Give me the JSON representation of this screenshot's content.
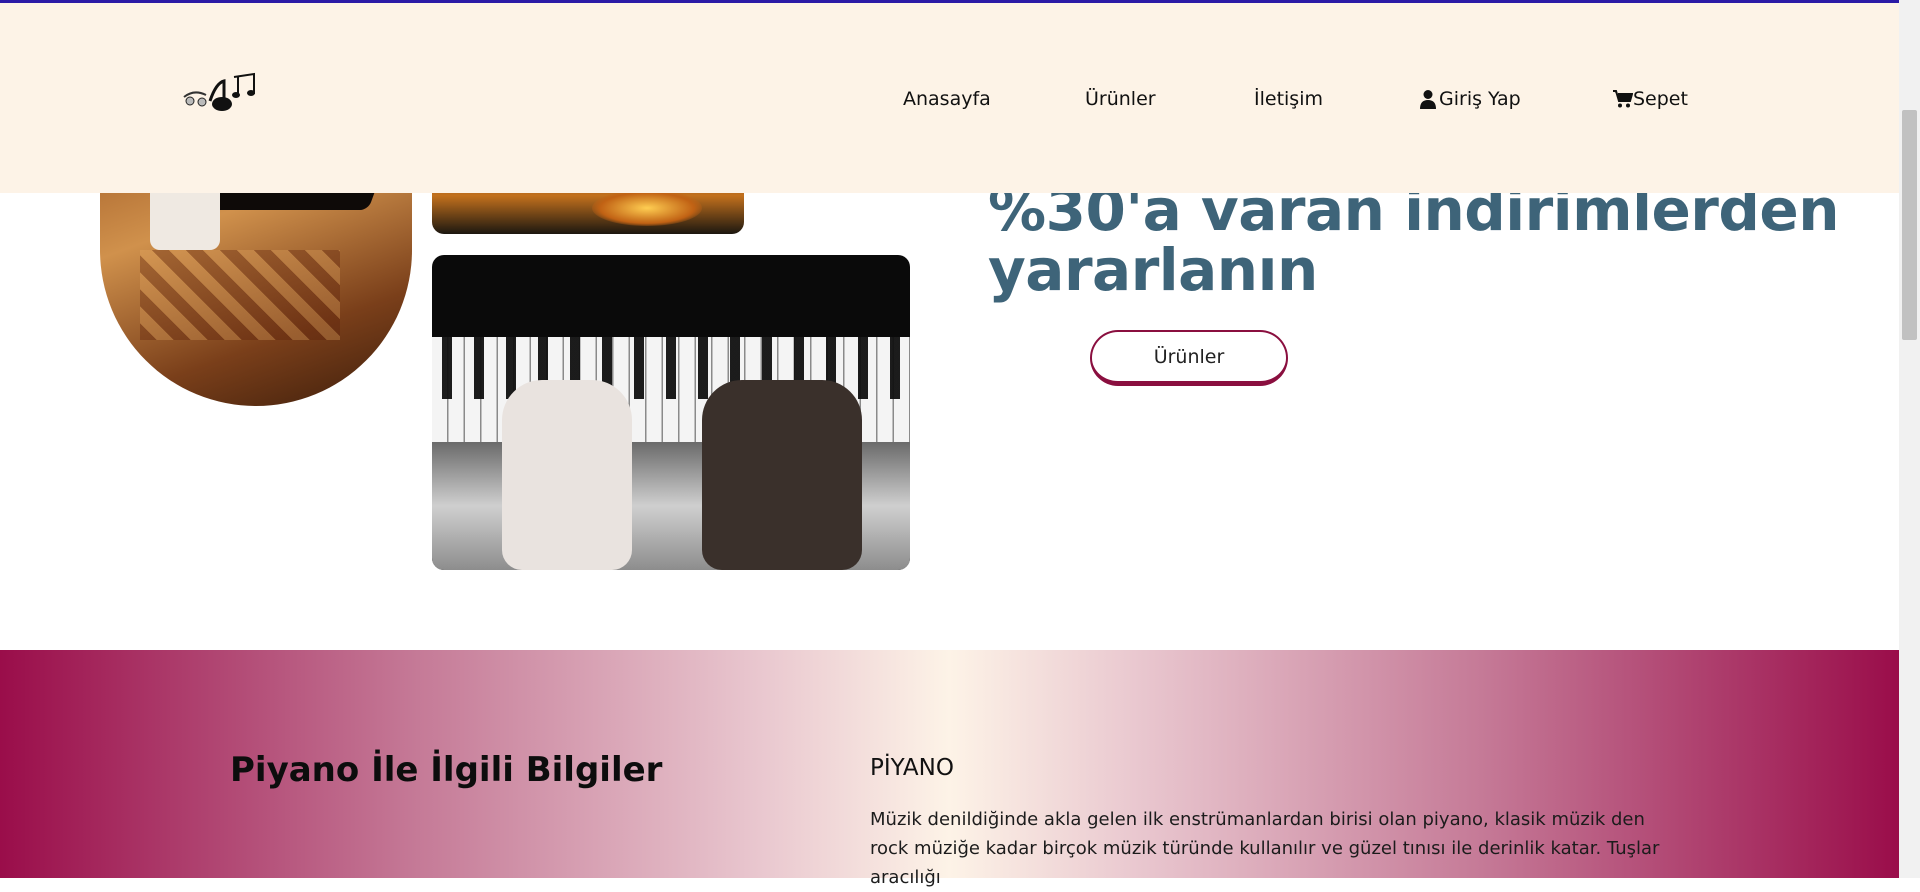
{
  "nav": {
    "logo_alt": "music logo",
    "items": [
      {
        "label": "Anasayfa",
        "icon": ""
      },
      {
        "label": "Ürünler",
        "icon": ""
      },
      {
        "label": "İletişim",
        "icon": ""
      },
      {
        "label": "Giriş Yap",
        "icon": "user-icon"
      },
      {
        "label": "Sepet",
        "icon": "cart-icon"
      }
    ]
  },
  "hero": {
    "promo_text": "%30'a varan indirimlerden yararlanın",
    "button_label": "Ürünler",
    "images": [
      "pianist-top-view-image",
      "sunset-beach-image",
      "piano-hands-image"
    ]
  },
  "info": {
    "title": "Piyano İle İlgili Bilgiler",
    "subtitle": "PİYANO",
    "text": "Müzik denildiğinde akla gelen ilk enstrümanlardan birisi olan piyano, klasik müzik den rock müziğe kadar birçok müzik türünde kullanılır ve güzel tınısı ile derinlik katar. Tuşlar aracılığı"
  },
  "colors": {
    "header_bg": "#fdf3e7",
    "promo_text": "#3e6479",
    "accent": "#8a0f3f",
    "top_line": "#2b1aa6"
  }
}
